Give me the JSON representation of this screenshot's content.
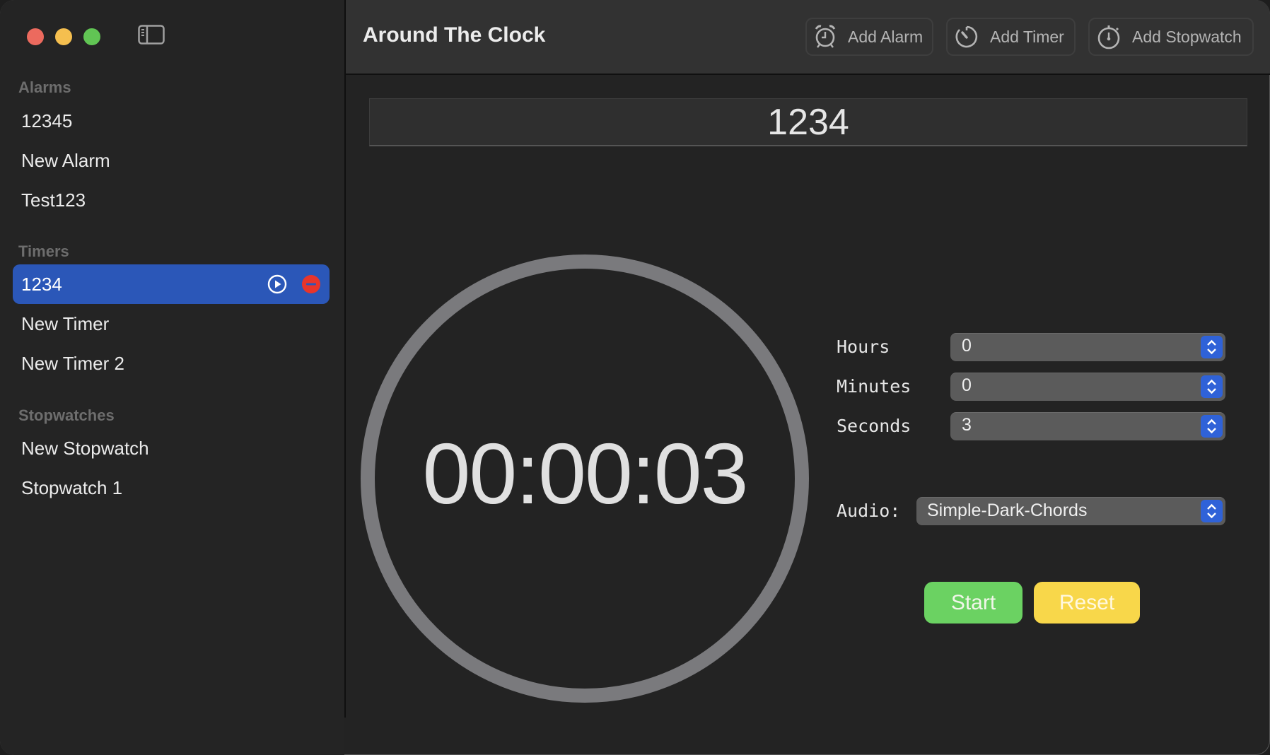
{
  "window": {
    "controls": [
      "close",
      "minimize",
      "zoom"
    ],
    "sidebar_toggle_icon": "sidebar-left-icon"
  },
  "sidebar": {
    "sections": [
      {
        "title": "Alarms",
        "items": [
          {
            "label": "12345"
          },
          {
            "label": "New Alarm"
          },
          {
            "label": "Test123"
          }
        ]
      },
      {
        "title": "Timers",
        "items": [
          {
            "label": "1234",
            "selected": true,
            "actions": [
              "play-circle-icon",
              "delete-minus-icon"
            ]
          },
          {
            "label": "New Timer"
          },
          {
            "label": "New Timer 2"
          }
        ]
      },
      {
        "title": "Stopwatches",
        "items": [
          {
            "label": "New Stopwatch"
          },
          {
            "label": "Stopwatch 1"
          }
        ]
      }
    ]
  },
  "header": {
    "title": "Around The Clock",
    "buttons": [
      {
        "label": "Add Alarm",
        "icon": "alarm-clock-icon"
      },
      {
        "label": "Add Timer",
        "icon": "timer-icon"
      },
      {
        "label": "Add Stopwatch",
        "icon": "stopwatch-icon"
      }
    ]
  },
  "main": {
    "name_field": "1234",
    "time_display": "00:00:03",
    "fields": [
      {
        "label": "Hours",
        "value": "0"
      },
      {
        "label": "Minutes",
        "value": "0"
      },
      {
        "label": "Seconds",
        "value": "3"
      }
    ],
    "audio": {
      "label": "Audio:",
      "value": "Simple-Dark-Chords"
    },
    "start_label": "Start",
    "reset_label": "Reset"
  },
  "colors": {
    "selection": "#2b57b8",
    "start": "#6bd262",
    "reset": "#f8d74a",
    "stepper": "#2f62d8",
    "delete": "#e8352b",
    "ring": "#7a7a7d"
  }
}
